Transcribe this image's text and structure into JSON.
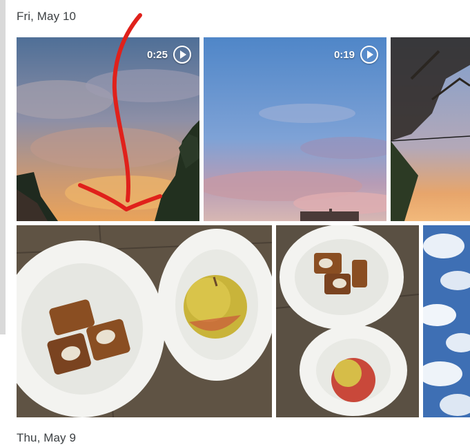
{
  "groups": [
    {
      "date": "Fri, May 10"
    },
    {
      "date": "Thu, May 9"
    }
  ],
  "photos": {
    "video1": {
      "duration": "0:25",
      "subject": "sunset clouds over trees"
    },
    "video2": {
      "duration": "0:19",
      "subject": "blue evening sky with pink clouds"
    },
    "photo3": {
      "subject": "tree branches against sunset sky"
    },
    "photo4": {
      "subject": "two paper bowls with pastries and an apple"
    },
    "photo5": {
      "subject": "bowls with pastries and apple, top view"
    },
    "photo6": {
      "subject": "blue sky with white clouds"
    }
  },
  "annotation": {
    "color": "#e0211b",
    "shape": "hand-drawn arrow pointing down"
  }
}
